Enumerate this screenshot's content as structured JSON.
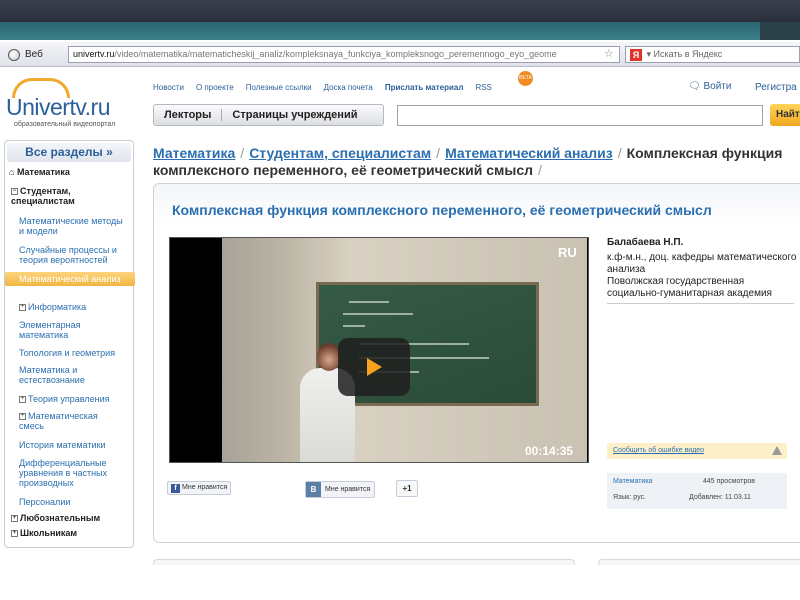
{
  "browser": {
    "tab_label": "Веб",
    "url_domain": "univertv.ru",
    "url_path": "/video/matematika/matematicheskij_analiz/kompleksnaya_funkciya_kompleksnogo_peremennogo_eyo_geome",
    "search_placeholder": "Искать в Яндекс",
    "search_engine_badge": "Я"
  },
  "site": {
    "logo_text": "Univertv.ru",
    "logo_tagline": "образовательный видеопортал",
    "nav": [
      "Новости",
      "О проекте",
      "Полезные ссылки",
      "Доска почета"
    ],
    "nav_submit": "Прислать материал",
    "beta_badge": "BETA",
    "nav_rss": "RSS",
    "login": "Войти",
    "register": "Регистра",
    "lecturers": "Лекторы",
    "institutions": "Страницы учреждений",
    "find_button": "Найт"
  },
  "sidebar": {
    "all_sections": "Все разделы   »",
    "category": "Математика",
    "group_students": "Студентам, специалистам",
    "items": [
      "Математические методы и модели",
      "Случайные процессы и теория вероятностей",
      "Математический анализ",
      "Информатика",
      "Элементарная математика",
      "Топология и геометрия",
      "Математика и естествознание",
      "Теория управления",
      "Математическая смесь",
      "История математики",
      "Дифференциальные уравнения в частных производных",
      "Персоналии"
    ],
    "group_curious": "Любознательным",
    "group_schoolkids": "Школьникам"
  },
  "breadcrumb": {
    "items": [
      "Математика",
      "Студентам, специалистам",
      "Математический анализ"
    ],
    "current": "Комплексная функция комплексного переменного, её геометрический смысл"
  },
  "video": {
    "title": "Комплексная функция комплексного переменного, её геометрический смысл",
    "lang_badge": "RU",
    "duration": "00:14:35"
  },
  "author": {
    "name": "Балабаева Н.П.",
    "position": "к.ф-м.н., доц. кафедры математического анализа",
    "affiliation": "Поволжская государственная социально-гуманитарная академия"
  },
  "report_error": "Сообщить об ошибке видео",
  "stats": {
    "category": "Математика",
    "views": "445 просмотров",
    "language": "Язык: рус.",
    "added": "Добавлен: 11.03.11"
  },
  "social": {
    "fb_like": "Мне нравится",
    "fb_icon": "f",
    "vk_like": "Мне нравится",
    "vk_icon": "B",
    "plus_one": "+1"
  }
}
